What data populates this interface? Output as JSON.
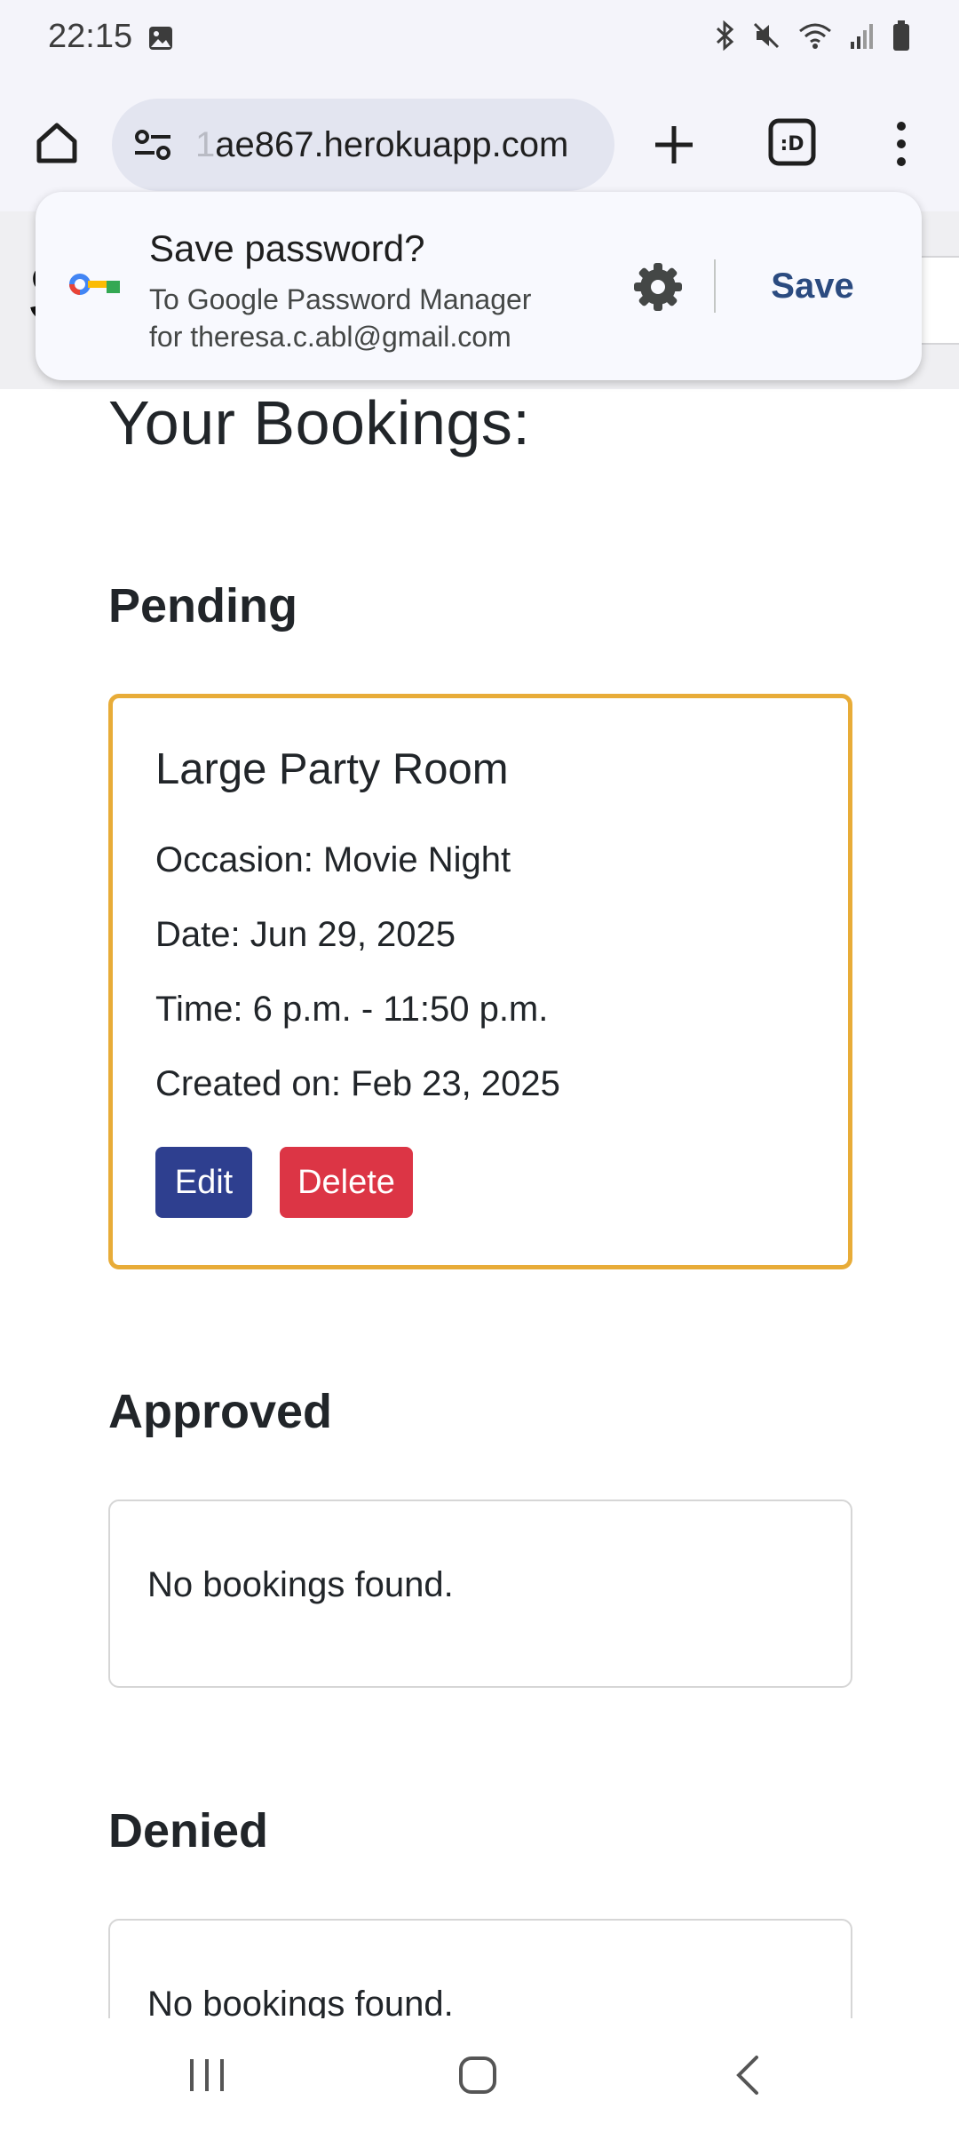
{
  "status_bar": {
    "time": "22:15",
    "icons": [
      "gallery-icon",
      "bluetooth-icon",
      "mute-icon",
      "wifi-icon",
      "signal-icon",
      "battery-icon"
    ]
  },
  "browser": {
    "url_prefix": "1",
    "url": "ae867.herokuapp.com",
    "icons": [
      "home-icon",
      "site-settings-icon",
      "new-tab-icon",
      "tab-switcher-icon",
      "more-menu-icon"
    ]
  },
  "save_password_popup": {
    "title": "Save password?",
    "subtitle_line1": "To Google Password Manager",
    "subtitle_line2": "for theresa.c.abl@gmail.com",
    "save_label": "Save",
    "accent_color": "#2b4b80"
  },
  "page": {
    "header_letter": "S",
    "bookings_title": "Your Bookings:",
    "sections": {
      "pending": {
        "heading": "Pending",
        "border_color": "#e8ac38",
        "booking": {
          "room": "Large Party Room",
          "occasion": "Occasion: Movie Night",
          "date": "Date: Jun 29, 2025",
          "time": "Time: 6 p.m. - 11:50 p.m.",
          "created": "Created on: Feb 23, 2025",
          "edit_label": "Edit",
          "delete_label": "Delete",
          "edit_color": "#2e3f8f",
          "delete_color": "#dc3545"
        }
      },
      "approved": {
        "heading": "Approved",
        "empty_text": "No bookings found."
      },
      "denied": {
        "heading": "Denied",
        "empty_text": "No bookings found."
      }
    }
  },
  "nav_bar": {
    "icons": [
      "recent-apps-icon",
      "home-nav-icon",
      "back-icon"
    ]
  }
}
